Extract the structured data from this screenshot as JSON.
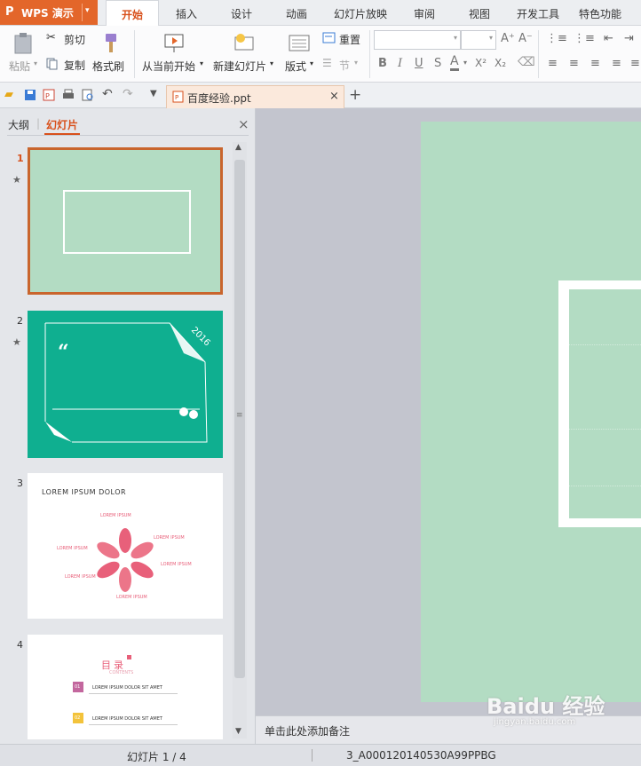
{
  "app": {
    "name": "WPS 演示"
  },
  "menu": {
    "tabs": [
      {
        "label": "开始"
      },
      {
        "label": "插入"
      },
      {
        "label": "设计"
      },
      {
        "label": "动画"
      },
      {
        "label": "幻灯片放映"
      },
      {
        "label": "审阅"
      },
      {
        "label": "视图"
      },
      {
        "label": "开发工具"
      },
      {
        "label": "特色功能"
      }
    ],
    "active": "开始"
  },
  "ribbon": {
    "paste": "粘贴",
    "cut": "剪切",
    "copy": "复制",
    "format_painter": "格式刷",
    "from_current": "从当前开始",
    "new_slide": "新建幻灯片",
    "layout": "版式",
    "reset": "重置",
    "section": "节",
    "font_name": "",
    "font_size": "",
    "bold": "B",
    "italic": "I",
    "underline": "U",
    "shadow": "S",
    "font_color": "A",
    "superscript": "X²",
    "subscript": "X₂"
  },
  "document": {
    "tab_title": "百度经验.ppt"
  },
  "panel": {
    "tab_outline": "大纲",
    "tab_slides": "幻灯片",
    "slides": [
      {
        "num": "1",
        "selected": true
      },
      {
        "num": "2",
        "year": "2016"
      },
      {
        "num": "3",
        "title": "LOREM IPSUM DOLOR",
        "items": [
          "LOREM IPSUM",
          "LOREM IPSUM",
          "LOREM IPSUM",
          "LOREM IPSUM",
          "LOREM IPSUM",
          "LOREM IPSUM"
        ]
      },
      {
        "num": "4",
        "title": "目录",
        "subtitle": "CONTENTS",
        "rows": [
          {
            "badge": "01",
            "text": "LOREM IPSUM DOLOR SIT AMET"
          },
          {
            "badge": "02",
            "text": "LOREM IPSUM DOLOR SIT AMET"
          }
        ]
      }
    ]
  },
  "notes": {
    "placeholder": "单击此处添加备注"
  },
  "status": {
    "slide_counter": "幻灯片 1 / 4",
    "template": "3_A000120140530A99PPBG"
  },
  "watermark": {
    "brand": "Baidu 经验",
    "url": "jingyan.baidu.com"
  },
  "colors": {
    "accent": "#e3662a",
    "slide_green": "#b3dcc3",
    "teal": "#0faf90",
    "pink": "#e8607a"
  }
}
